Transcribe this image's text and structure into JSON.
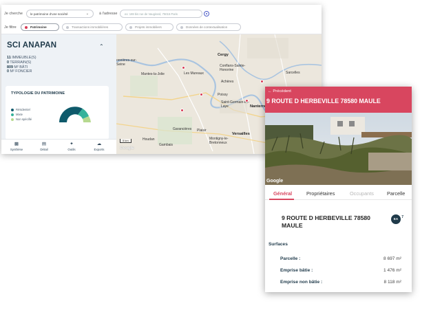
{
  "search": {
    "je_cherche": "Je cherche",
    "select_value": "le patrimoine d'une société",
    "a_adresse": "à l'adresse",
    "address_placeholder": "ex: 169 bis rue de Vaugirard, 75015 Paris",
    "je_filtre": "Je filtre"
  },
  "filters": [
    {
      "label": "Patrimoine",
      "color": "#d83a55"
    },
    {
      "label": "Transactions immobilières",
      "color": "#c6c9d0"
    },
    {
      "label": "Projets immobiliers",
      "color": "#c6c9d0"
    },
    {
      "label": "Données de contextualisation",
      "color": "#c6c9d0"
    }
  ],
  "company": {
    "name": "SCI ANAPAN",
    "stats": [
      {
        "value": "11",
        "label": "IMMEUBLE(S)"
      },
      {
        "value": "0",
        "label": "TERRAIN(S)"
      },
      {
        "value": "809",
        "label": "M² BÂTI"
      },
      {
        "value": "0",
        "label": "M² FONCIER"
      }
    ]
  },
  "typology": {
    "title": "TYPOLOGIE DU PATRIMOINE",
    "items": [
      {
        "label": "Résidentiel",
        "color": "#0e5a6b"
      },
      {
        "label": "Mixte",
        "color": "#36b29a"
      },
      {
        "label": "Non spécifié",
        "color": "#b6d98f"
      }
    ]
  },
  "bottom_tabs": [
    {
      "label": "Synthèse",
      "icon": "bar-chart-icon"
    },
    {
      "label": "Détail",
      "icon": "document-icon"
    },
    {
      "label": "Outils",
      "icon": "wrench-icon"
    },
    {
      "label": "Exports",
      "icon": "cloud-download-icon"
    }
  ],
  "map": {
    "towns": [
      {
        "name": "Cergy",
        "big": true
      },
      {
        "name": "Conflans-Sainte-Honorine"
      },
      {
        "name": "Sarcelles"
      },
      {
        "name": "Mantes-la-Jolie"
      },
      {
        "name": "Les Mureaux"
      },
      {
        "name": "Poissy"
      },
      {
        "name": "Achères"
      },
      {
        "name": "Saint-Germain-en-Laye"
      },
      {
        "name": "Nanterre",
        "big": true
      },
      {
        "name": "Garancières"
      },
      {
        "name": "Plaisir"
      },
      {
        "name": "Versailles",
        "big": true
      },
      {
        "name": "Houdan"
      },
      {
        "name": "Gambais"
      },
      {
        "name": "Montigny-le-Bretonneux"
      },
      {
        "name": "onnières-sur-Seine"
      }
    ],
    "scale": "5 km",
    "watermark": "Google"
  },
  "detail": {
    "back_label": "Précédent",
    "title": "9 ROUTE D HERBEVILLE 78580 MAULE",
    "photo_watermark": "Google",
    "tabs": [
      {
        "label": "Général",
        "state": "active"
      },
      {
        "label": "Propriétaires",
        "state": "normal"
      },
      {
        "label": "Occupants",
        "state": "disabled"
      },
      {
        "label": "Parcelle",
        "state": "normal"
      }
    ],
    "address": "9 ROUTE D HERBEVILLE 78580 MAULE",
    "badge": "EA",
    "badge_sup": "7",
    "section_title": "Surfaces",
    "rows": [
      {
        "label": "Parcelle :",
        "value": "8 697 m²"
      },
      {
        "label": "Emprise bâtie :",
        "value": "1 476 m²"
      },
      {
        "label": "Emprise non bâtie :",
        "value": "8 118 m²"
      }
    ]
  }
}
